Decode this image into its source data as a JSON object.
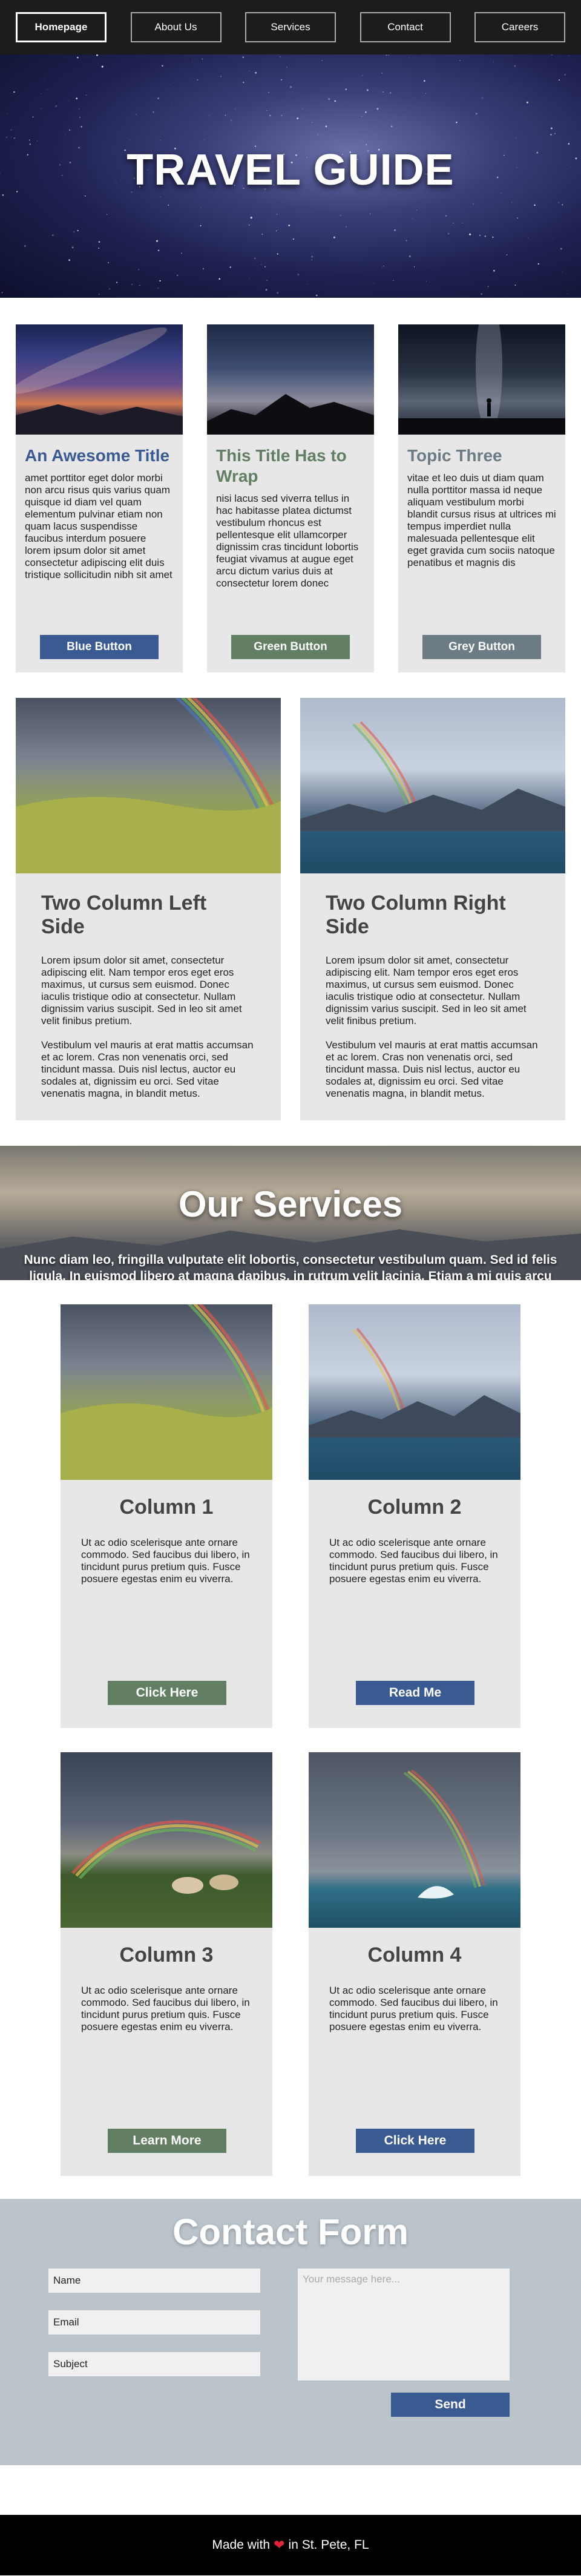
{
  "nav": {
    "items": [
      "Homepage",
      "About Us",
      "Services",
      "Contact",
      "Careers"
    ],
    "active_index": 0
  },
  "hero": {
    "title": "TRAVEL GUIDE"
  },
  "cards3": [
    {
      "title": "An Awesome Title",
      "title_color": "#3a5a92",
      "text": "amet porttitor eget dolor morbi non arcu risus quis varius quam quisque id diam vel quam elementum pulvinar etiam non quam lacus suspendisse faucibus interdum posuere lorem ipsum dolor sit amet consectetur adipiscing elit duis tristique sollicitudin nibh sit amet",
      "button": "Blue Button",
      "button_color": "#3a5a92"
    },
    {
      "title": "This Title Has to Wrap",
      "title_color": "#627f63",
      "text": "nisi lacus sed viverra tellus in hac habitasse platea dictumst vestibulum rhoncus est pellentesque elit ullamcorper dignissim cras tincidunt lobortis feugiat vivamus at augue eget arcu dictum varius duis at consectetur lorem donec",
      "button": "Green Button",
      "button_color": "#627f63"
    },
    {
      "title": "Topic Three",
      "title_color": "#6b7c85",
      "text": "vitae et leo duis ut diam quam nulla porttitor massa id neque aliquam vestibulum morbi blandit cursus risus at ultrices mi tempus imperdiet nulla malesuada pellentesque elit eget gravida cum sociis natoque penatibus et magnis dis",
      "button": "Grey Button",
      "button_color": "#6b7c85"
    }
  ],
  "cols2": [
    {
      "title": "Two Column Left Side",
      "p1": "Lorem ipsum dolor sit amet, consectetur adipiscing elit. Nam tempor eros eget eros maximus, ut cursus sem euismod. Donec iaculis tristique odio at consectetur. Nullam dignissim varius suscipit. Sed in leo sit amet velit finibus pretium.",
      "p2": "Vestibulum vel mauris at erat mattis accumsan et ac lorem. Cras non venenatis orci, sed tincidunt massa. Duis nisl lectus, auctor eu sodales at, dignissim eu orci. Sed vitae venenatis magna, in blandit metus."
    },
    {
      "title": "Two Column Right Side",
      "p1": "Lorem ipsum dolor sit amet, consectetur adipiscing elit. Nam tempor eros eget eros maximus, ut cursus sem euismod. Donec iaculis tristique odio at consectetur. Nullam dignissim varius suscipit. Sed in leo sit amet velit finibus pretium.",
      "p2": "Vestibulum vel mauris at erat mattis accumsan et ac lorem. Cras non venenatis orci, sed tincidunt massa. Duis nisl lectus, auctor eu sodales at, dignissim eu orci. Sed vitae venenatis magna, in blandit metus."
    }
  ],
  "services": {
    "title": "Our Services",
    "text": "Nunc diam leo, fringilla vulputate elit lobortis, consectetur vestibulum quam. Sed id felis ligula. In euismod libero at magna dapibus, in rutrum velit lacinia. Etiam a mi quis arcu varius condimentum."
  },
  "cols4": [
    {
      "title": "Column 1",
      "text": "Ut ac odio scelerisque ante ornare commodo. Sed faucibus dui libero, in tincidunt purus pretium quis. Fusce posuere egestas enim eu viverra.",
      "button": "Click Here",
      "button_color": "#627f63"
    },
    {
      "title": "Column 2",
      "text": "Ut ac odio scelerisque ante ornare commodo. Sed faucibus dui libero, in tincidunt purus pretium quis. Fusce posuere egestas enim eu viverra.",
      "button": "Read Me",
      "button_color": "#3a5a92"
    },
    {
      "title": "Column 3",
      "text": "Ut ac odio scelerisque ante ornare commodo. Sed faucibus dui libero, in tincidunt purus pretium quis. Fusce posuere egestas enim eu viverra.",
      "button": "Learn More",
      "button_color": "#627f63"
    },
    {
      "title": "Column 4",
      "text": "Ut ac odio scelerisque ante ornare commodo. Sed faucibus dui libero, in tincidunt purus pretium quis. Fusce posuere egestas enim eu viverra.",
      "button": "Click Here",
      "button_color": "#3a5a92"
    }
  ],
  "contact": {
    "title": "Contact Form",
    "name_placeholder": "Name",
    "email_placeholder": "Email",
    "subject_placeholder": "Subject",
    "message_placeholder": "Your message here...",
    "send": "Send"
  },
  "footer": {
    "before": "Made with",
    "heart_icon": "heart-icon",
    "after": "in St. Pete, FL"
  }
}
